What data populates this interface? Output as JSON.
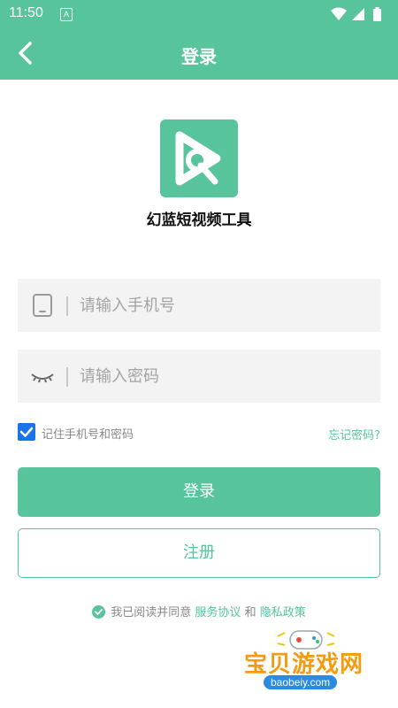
{
  "status_bar": {
    "time": "11:50",
    "notification_badge": "A",
    "icons": [
      "wifi-icon",
      "signal-icon",
      "battery-icon"
    ]
  },
  "header": {
    "title": "登录",
    "back_icon": "chevron-left-icon"
  },
  "app": {
    "name": "幻蓝短视频工具",
    "logo_icon": "play-wrench-logo"
  },
  "form": {
    "phone": {
      "placeholder": "请输入手机号",
      "value": "",
      "icon": "phone-icon"
    },
    "password": {
      "placeholder": "请输入密码",
      "value": "",
      "icon": "eye-closed-icon"
    },
    "remember_label": "记住手机号和密码",
    "remember_checked": true,
    "forgot_label": "忘记密码?"
  },
  "buttons": {
    "login": "登录",
    "register": "注册"
  },
  "agreement": {
    "prefix": "我已阅读并同意",
    "service_link": "服务协议",
    "and": "和",
    "privacy_link": "隐私政策",
    "checked": true
  },
  "watermark": {
    "title": "宝贝游戏网",
    "url": "baobeiy.com"
  },
  "colors": {
    "accent": "#57c49b",
    "checkbox": "#1a73e8",
    "watermark_orange": "#f39c12",
    "watermark_blue": "#2b8be0"
  }
}
